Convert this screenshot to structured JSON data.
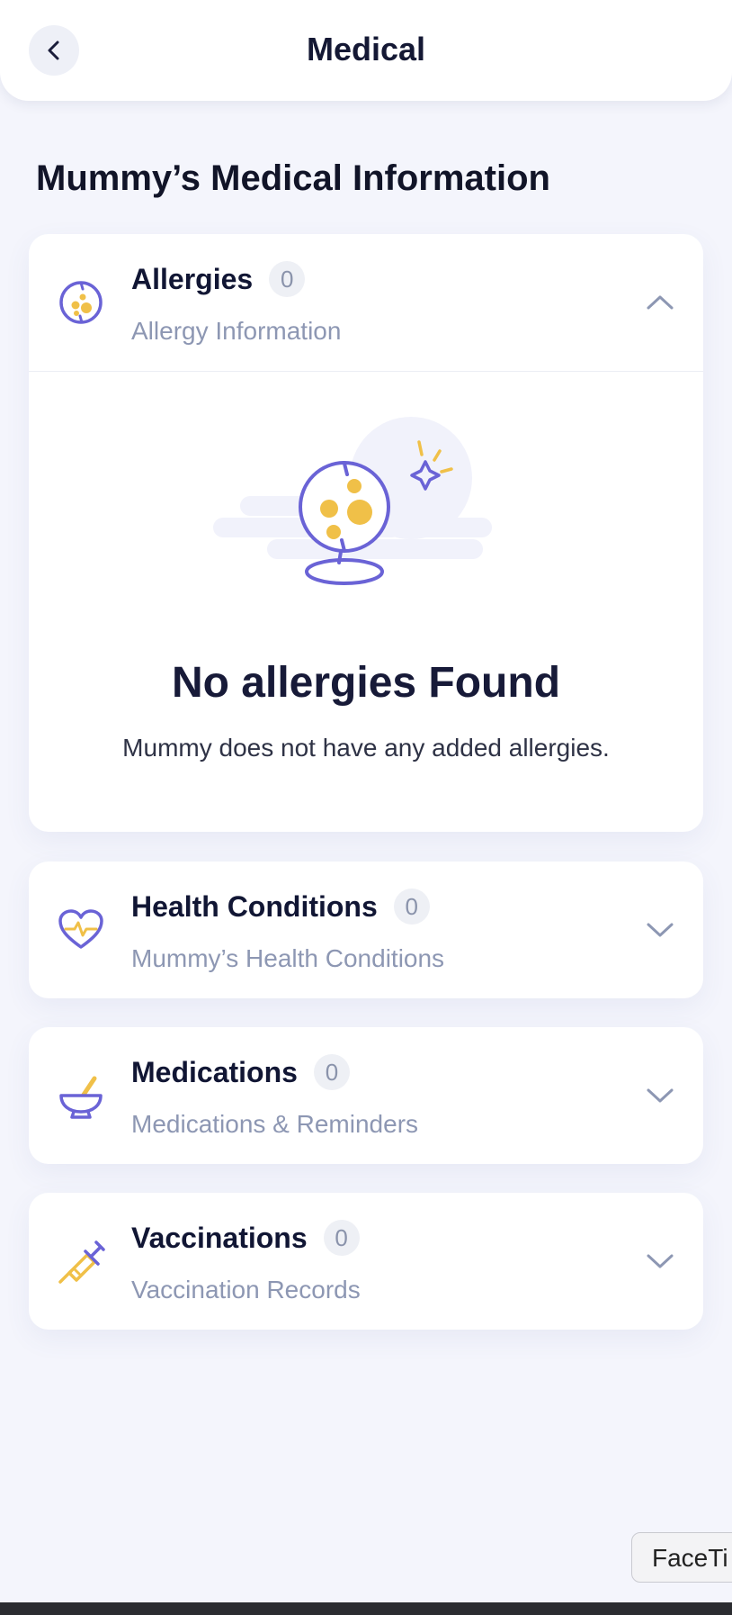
{
  "header": {
    "title": "Medical",
    "back_icon": "chevron-left-icon"
  },
  "page": {
    "section_title": "Mummy’s Medical Information"
  },
  "cards": [
    {
      "title": "Allergies",
      "count": "0",
      "subtitle": "Allergy Information",
      "icon": "allergy-icon",
      "expanded": true,
      "empty_title": "No allergies Found",
      "empty_desc": "Mummy does not have any added allergies."
    },
    {
      "title": "Health Conditions",
      "count": "0",
      "subtitle": "Mummy’s Health Conditions",
      "icon": "heart-pulse-icon",
      "expanded": false
    },
    {
      "title": "Medications",
      "count": "0",
      "subtitle": "Medications & Reminders",
      "icon": "mortar-pestle-icon",
      "expanded": false
    },
    {
      "title": "Vaccinations",
      "count": "0",
      "subtitle": "Vaccination Records",
      "icon": "syringe-icon",
      "expanded": false
    }
  ],
  "overlay": {
    "facetime_label": "FaceTi"
  },
  "colors": {
    "accent_purple": "#6a63d6",
    "accent_yellow": "#f0c048",
    "background": "#f4f5fc"
  }
}
